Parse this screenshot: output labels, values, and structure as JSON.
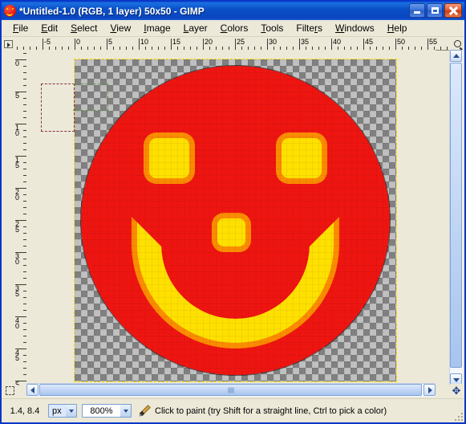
{
  "window": {
    "title": "*Untitled-1.0 (RGB, 1 layer) 50x50 - GIMP",
    "icon": "smiley-face-icon",
    "buttons": {
      "minimize": "minimize-icon",
      "maximize": "maximize-icon",
      "close": "close-icon"
    },
    "titlebar_color": "#0a46c0",
    "border_color": "#0a36c8"
  },
  "menubar": {
    "items": [
      {
        "label": "File",
        "mnemonic": "F"
      },
      {
        "label": "Edit",
        "mnemonic": "E"
      },
      {
        "label": "Select",
        "mnemonic": "S"
      },
      {
        "label": "View",
        "mnemonic": "V"
      },
      {
        "label": "Image",
        "mnemonic": "I"
      },
      {
        "label": "Layer",
        "mnemonic": "L"
      },
      {
        "label": "Colors",
        "mnemonic": "C"
      },
      {
        "label": "Tools",
        "mnemonic": "T"
      },
      {
        "label": "Filters",
        "mnemonic": "r"
      },
      {
        "label": "Windows",
        "mnemonic": "W"
      },
      {
        "label": "Help",
        "mnemonic": "H"
      }
    ]
  },
  "rulers": {
    "unit": "px",
    "horizontal": {
      "labels": [
        "0",
        "5",
        "10",
        "15",
        "20",
        "25",
        "30",
        "35",
        "40",
        "45",
        "50",
        "55"
      ],
      "origin_label": "0",
      "start_label": "-5",
      "pixels_per_unit": 8,
      "label_step": 5
    },
    "vertical": {
      "labels": [
        "0",
        "5",
        "10",
        "15",
        "20",
        "25",
        "30",
        "35",
        "40",
        "45"
      ],
      "pixels_per_unit": 8,
      "label_step": 5
    },
    "corner_button": "menu-arrow-icon",
    "zoom_corner_button": "zoom-image-icon"
  },
  "canvas": {
    "image_name": "Untitled-1.0",
    "image_size": "50x50",
    "color_mode": "RGB",
    "layer_count": "1 layer",
    "zoom": "800%",
    "layer_boundary_color": "#ffe000",
    "background": "checkerboard-transparency",
    "content": {
      "description": "smiley-face",
      "face_color": "#ee1511",
      "feature_color": "#ffe000",
      "feature_edge_color": "#fb8c00",
      "parts": [
        "left-eye",
        "right-eye",
        "nose",
        "mouth"
      ]
    },
    "selection": {
      "type": "marching-ants-rectangle",
      "visible": true
    }
  },
  "scrollbars": {
    "vertical": {
      "up": "scroll-up-icon",
      "down": "scroll-down-icon"
    },
    "horizontal": {
      "left": "scroll-left-icon",
      "right": "scroll-right-icon"
    }
  },
  "quickmask": {
    "label": "quick-mask-toggle"
  },
  "navigate": {
    "label": "navigation-preview"
  },
  "statusbar": {
    "pointer_position": "1.4, 8.4",
    "unit": "px",
    "zoom_level": "800%",
    "tool_icon": "paintbrush-icon",
    "message": "Click to paint (try Shift for a straight line, Ctrl to pick a color)"
  }
}
